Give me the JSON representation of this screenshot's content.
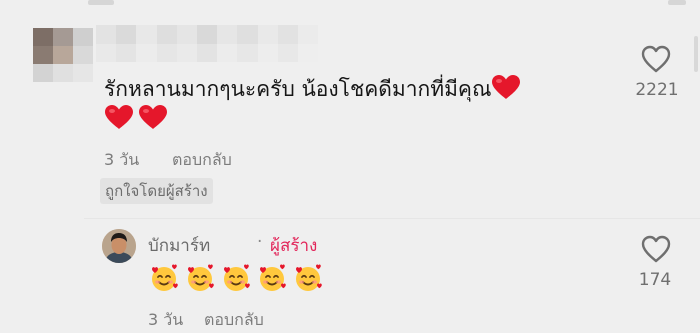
{
  "comment": {
    "text": "รักหลานมากๆนะครับ น้องโชคดีมากที่มีคุณ",
    "trailing_emoji": [
      "red-heart",
      "red-heart",
      "red-heart"
    ],
    "date": "3 วัน",
    "reply_label": "ตอบกลับ",
    "liked_by_creator": "ถูกใจโดยผู้สร้าง",
    "like_count": "2221"
  },
  "reply": {
    "username": "บักมาร์ท",
    "separator": "·",
    "creator_label": "ผู้สร้าง",
    "emoji": [
      "smiling-face-with-hearts",
      "smiling-face-with-hearts",
      "smiling-face-with-hearts",
      "smiling-face-with-hearts",
      "smiling-face-with-hearts"
    ],
    "date": "3 วัน",
    "reply_label": "ตอบกลับ",
    "like_count": "174"
  },
  "colors": {
    "background": "#efefef",
    "creator_accent": "#e2265a",
    "heart_red": "#e5172b",
    "meta_gray": "#7c7c7c"
  }
}
